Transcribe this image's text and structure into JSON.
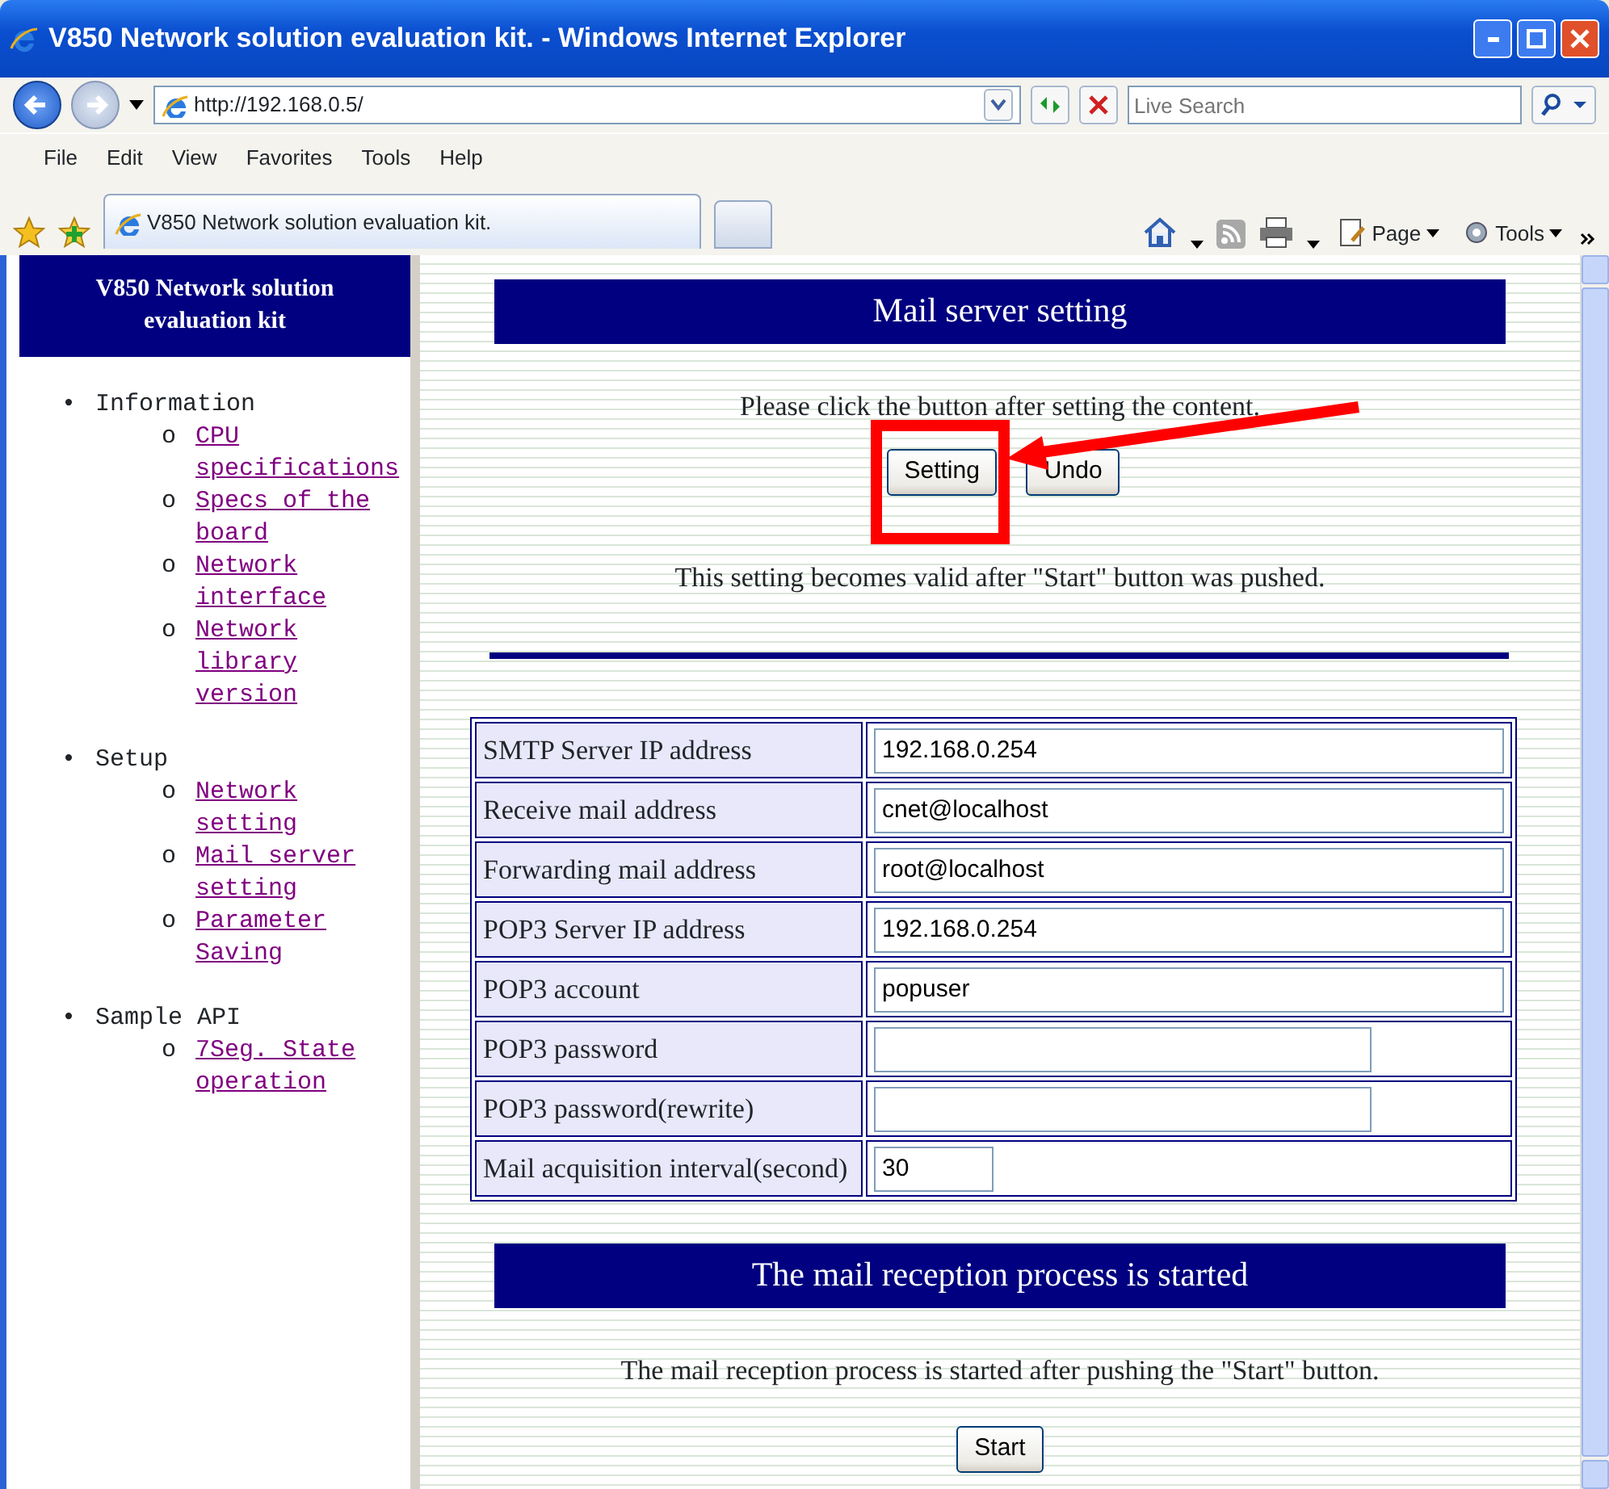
{
  "window": {
    "title": "V850 Network solution evaluation kit. - Windows Internet Explorer"
  },
  "address_bar": {
    "url": "http://192.168.0.5/",
    "search_placeholder": "Live Search"
  },
  "menu": [
    "File",
    "Edit",
    "View",
    "Favorites",
    "Tools",
    "Help"
  ],
  "tab": {
    "title": "V850 Network solution evaluation kit."
  },
  "command_bar": [
    "Page",
    "Tools"
  ],
  "sidebar": {
    "title": "V850 Network solution evaluation kit",
    "sections": [
      {
        "bullet": "•",
        "label": "Information",
        "children": [
          {
            "bullet": "o",
            "label": "CPU specifications"
          },
          {
            "bullet": "o",
            "label": "Specs of the board"
          },
          {
            "bullet": "o",
            "label": "Network interface"
          },
          {
            "bullet": "o",
            "label": "Network library version"
          }
        ]
      },
      {
        "bullet": "•",
        "label": "Setup",
        "children": [
          {
            "bullet": "o",
            "label": "Network setting"
          },
          {
            "bullet": "o",
            "label": "Mail server setting"
          },
          {
            "bullet": "o",
            "label": "Parameter Saving"
          }
        ]
      },
      {
        "bullet": "•",
        "label": "Sample API",
        "children": [
          {
            "bullet": "o",
            "label": "7Seg. State operation"
          }
        ]
      }
    ]
  },
  "settings": {
    "heading": "Mail server setting",
    "instruction": "Please click the button after setting the content.",
    "buttons": [
      "Setting",
      "Undo"
    ],
    "note": "This setting becomes valid after \"Start\" button was pushed.",
    "fields": [
      {
        "label": "SMTP Server IP address",
        "value": "192.168.0.254",
        "kind": "text"
      },
      {
        "label": "Receive mail address",
        "value": "cnet@localhost",
        "kind": "text"
      },
      {
        "label": "Forwarding mail address",
        "value": "root@localhost",
        "kind": "text"
      },
      {
        "label": "POP3 Server IP address",
        "value": "192.168.0.254",
        "kind": "text"
      },
      {
        "label": "POP3 account",
        "value": "popuser",
        "kind": "text"
      },
      {
        "label": "POP3 password",
        "kind": "password"
      },
      {
        "label": "POP3 password(rewrite)",
        "kind": "password"
      },
      {
        "label": "Mail acquisition interval(second)",
        "value": "30",
        "kind": "number"
      }
    ]
  },
  "reception": {
    "heading": "The mail reception process is started",
    "text": "The mail reception process is started after pushing the \"Start\" button.",
    "button": "Start"
  },
  "annotations": {
    "highlight_box": true,
    "arrow": true
  }
}
